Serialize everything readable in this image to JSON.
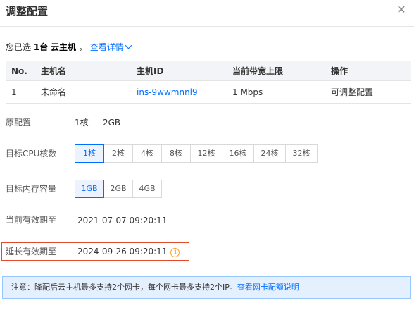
{
  "dialog": {
    "title": "调整配置",
    "close_glyph": "✕"
  },
  "selection": {
    "prefix": "您已选",
    "count": "1台",
    "unit": "云主机",
    "sep": "，",
    "details_link": "查看详情"
  },
  "table": {
    "headers": [
      "No.",
      "主机名",
      "主机ID",
      "当前带宽上限",
      "操作"
    ],
    "rows": [
      {
        "no": "1",
        "name": "未命名",
        "id": "ins-9wwmnnl9",
        "bandwidth": "1 Mbps",
        "action": "可调整配置"
      }
    ]
  },
  "original_config": {
    "label": "原配置",
    "cpu": "1核",
    "memory": "2GB"
  },
  "cpu": {
    "label": "目标CPU核数",
    "options": [
      "1核",
      "2核",
      "4核",
      "8核",
      "12核",
      "16核",
      "24核",
      "32核"
    ],
    "selected": "1核"
  },
  "memory": {
    "label": "目标内存容量",
    "options": [
      "1GB",
      "2GB",
      "4GB"
    ],
    "selected": "1GB"
  },
  "current_expiry": {
    "label": "当前有效期至",
    "value": "2021-07-07 09:20:11"
  },
  "extended_expiry": {
    "label": "延长有效期至",
    "value": "2024-09-26 09:20:11",
    "icon": "info-icon",
    "icon_glyph": "i"
  },
  "notice": {
    "text": "注意：降配后云主机最多支持2个网卡，每个网卡最多支持2个IP。",
    "link": "查看网卡配额说明"
  },
  "colors": {
    "accent": "#006eff",
    "highlight_border": "#e24b2a",
    "notice_bg": "#e5f0ff",
    "warning_icon": "#ff9c19"
  }
}
